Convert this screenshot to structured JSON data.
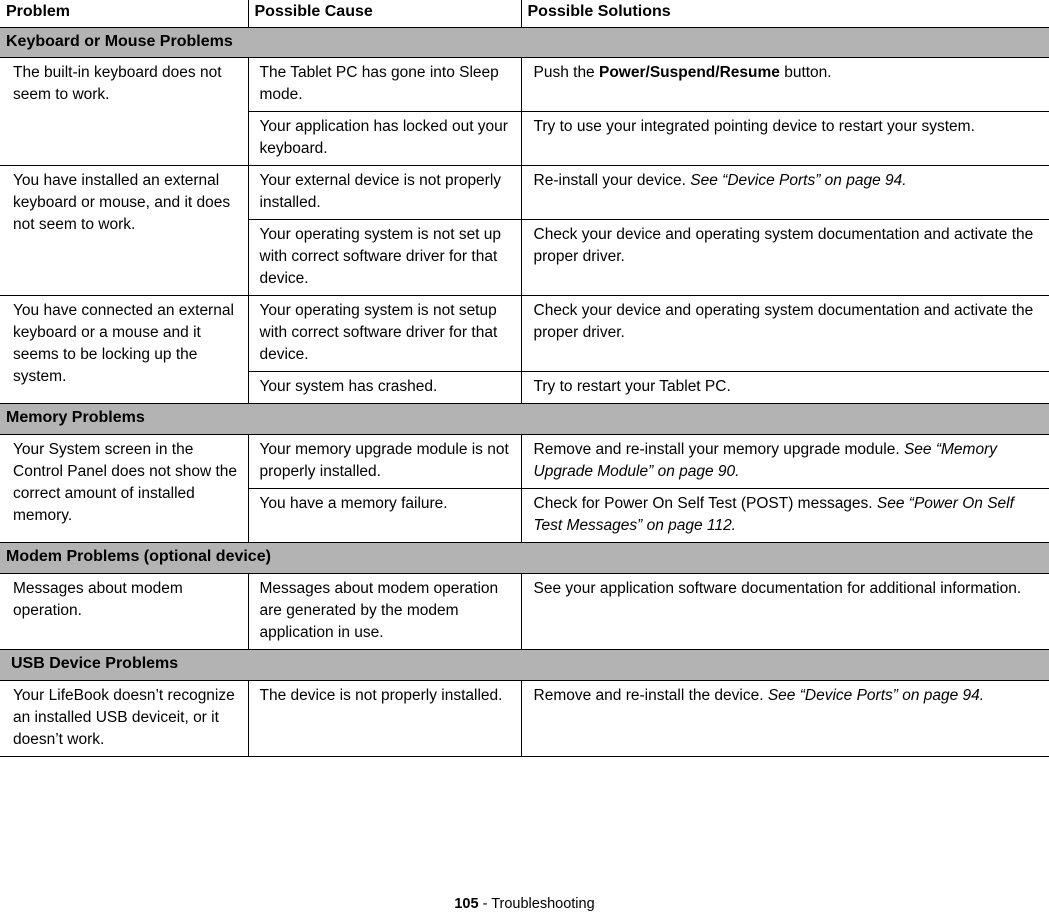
{
  "document": {
    "columns": [
      "Problem",
      "Possible Cause",
      "Possible Solutions"
    ],
    "footer": {
      "page_number": "105",
      "separator": " - ",
      "chapter": "Troubleshooting"
    },
    "colors": {
      "section_band": "#b3b3b3",
      "border": "#000000",
      "text": "#000000",
      "background": "#ffffff"
    }
  },
  "sections": [
    {
      "title": "Keyboard or Mouse Problems",
      "indented": false,
      "groups": [
        {
          "problem": "The built-in keyboard does not seem to work.",
          "rows": [
            {
              "cause": "The Tablet PC has gone into Sleep mode.",
              "solution_parts": [
                {
                  "text": "Push the ",
                  "style": "normal"
                },
                {
                  "text": "Power/Suspend/Resume",
                  "style": "bold"
                },
                {
                  "text": " button.",
                  "style": "normal"
                }
              ]
            },
            {
              "cause": "Your application has locked out your keyboard.",
              "solution_parts": [
                {
                  "text": "Try to use your integrated pointing device to restart your system.",
                  "style": "normal"
                }
              ]
            }
          ]
        },
        {
          "problem": "You have installed an external keyboard or mouse, and it does not seem to work.",
          "rows": [
            {
              "cause": "Your external device is not properly installed.",
              "solution_parts": [
                {
                  "text": "Re-install your device. ",
                  "style": "normal"
                },
                {
                  "text": "See “Device Ports” on page 94.",
                  "style": "italic"
                }
              ]
            },
            {
              "cause": "Your operating system is not set up with correct software driver for that device.",
              "solution_parts": [
                {
                  "text": "Check your device and operating system documentation and activate the proper driver.",
                  "style": "normal"
                }
              ]
            }
          ]
        },
        {
          "problem": "You have connected an external keyboard or a mouse and it seems to be locking up the system.",
          "rows": [
            {
              "cause": "Your operating system is not setup with correct software driver for that device.",
              "solution_parts": [
                {
                  "text": "Check your device and operating system documentation and activate the proper driver.",
                  "style": "normal"
                }
              ]
            },
            {
              "cause": "Your system has crashed.",
              "solution_parts": [
                {
                  "text": "Try to restart your Tablet PC.",
                  "style": "normal"
                }
              ]
            }
          ]
        }
      ]
    },
    {
      "title": "Memory Problems",
      "indented": false,
      "groups": [
        {
          "problem": "Your System screen in the Control Panel does not show the correct amount of installed memory.",
          "rows": [
            {
              "cause": "Your memory upgrade module is not properly installed.",
              "solution_parts": [
                {
                  "text": "Remove and re-install your memory upgrade module. ",
                  "style": "normal"
                },
                {
                  "text": "See “Memory Upgrade Module” on page 90.",
                  "style": "italic"
                }
              ]
            },
            {
              "cause": "You have a memory failure.",
              "solution_parts": [
                {
                  "text": "Check for Power On Self Test (POST) messages. ",
                  "style": "normal"
                },
                {
                  "text": "See “Power On Self Test Messages” on page 112.",
                  "style": "italic"
                }
              ]
            }
          ]
        }
      ]
    },
    {
      "title": "Modem Problems (optional device)",
      "indented": false,
      "groups": [
        {
          "problem": "Messages about modem operation.",
          "rows": [
            {
              "cause": "Messages about modem operation are generated by the modem application in use.",
              "solution_parts": [
                {
                  "text": "See your application software documentation for additional information.",
                  "style": "normal"
                }
              ]
            }
          ]
        }
      ]
    },
    {
      "title": "USB Device Problems",
      "indented": true,
      "groups": [
        {
          "problem": "Your LifeBook doesn’t recognize an installed USB deviceit, or it doesn’t work.",
          "rows": [
            {
              "cause": "The device is not properly installed.",
              "solution_parts": [
                {
                  "text": "Remove and re-install the device. ",
                  "style": "normal"
                },
                {
                  "text": "See “Device Ports” on page 94.",
                  "style": "italic"
                }
              ]
            }
          ]
        }
      ]
    }
  ]
}
